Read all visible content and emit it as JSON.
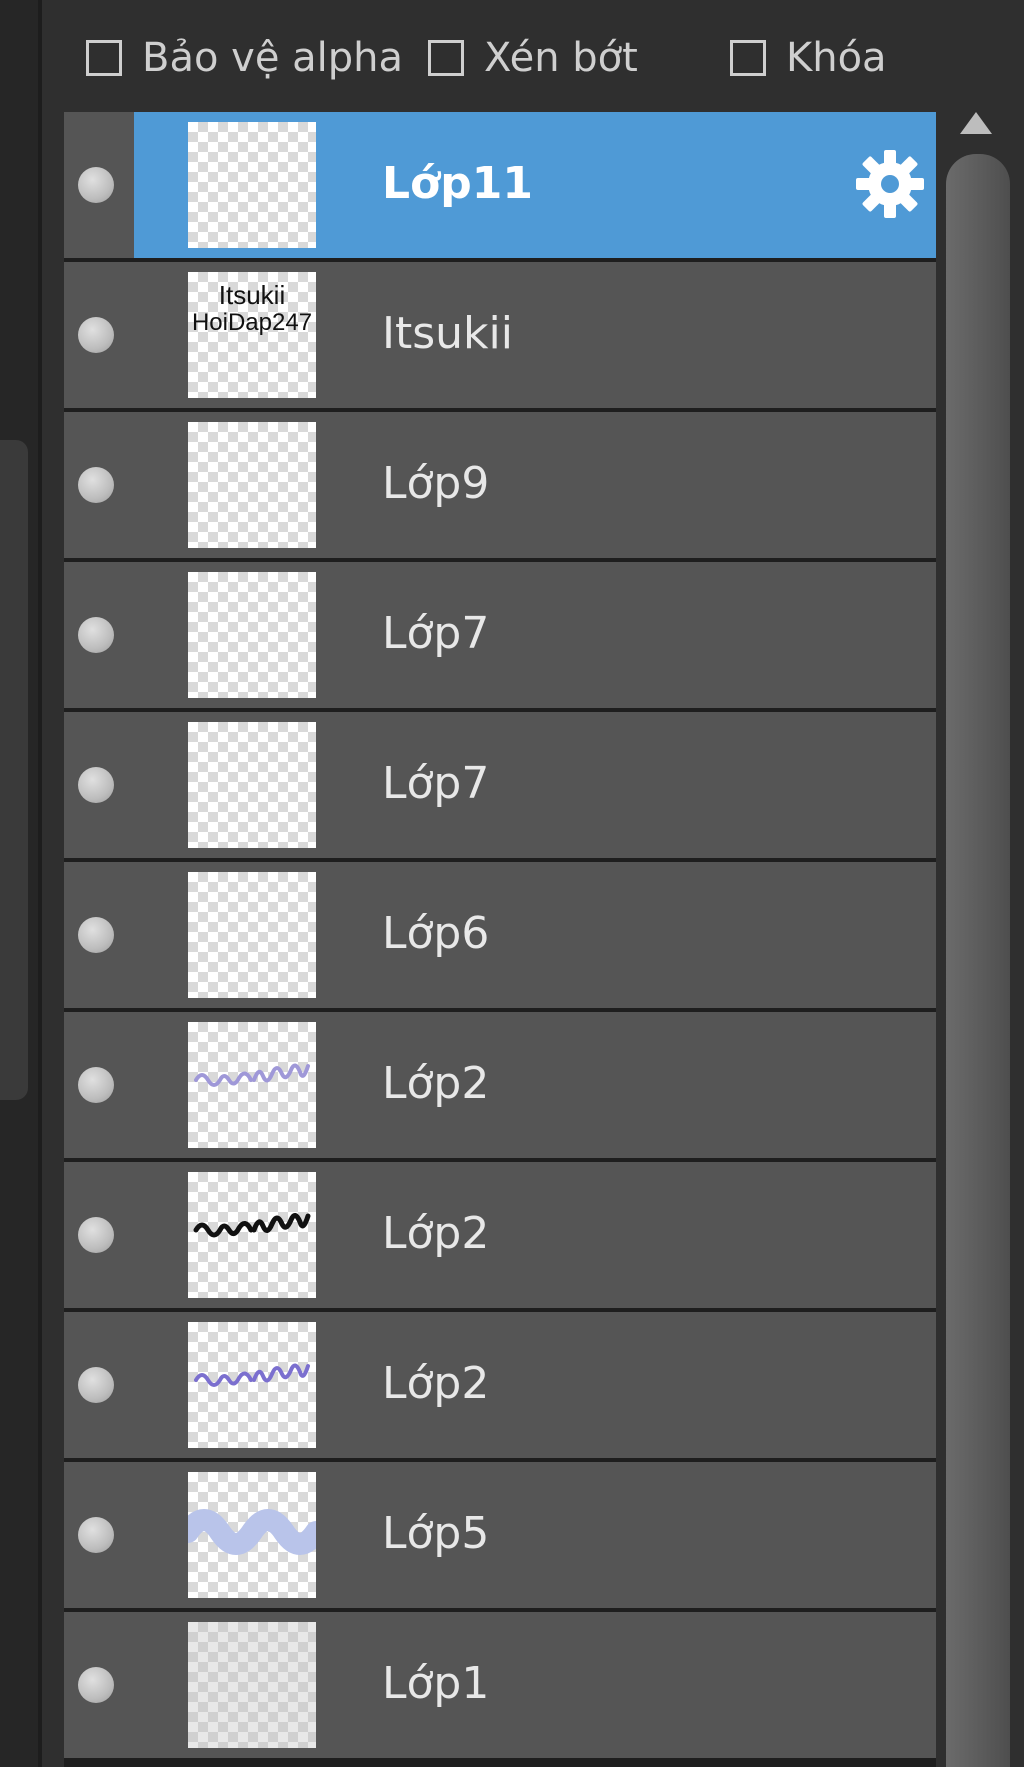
{
  "options": {
    "alpha_protect_label": "Bảo vệ alpha",
    "clip_label": "Xén bớt",
    "lock_label": "Khóa",
    "alpha_protect_checked": false,
    "clip_checked": false,
    "lock_checked": false
  },
  "layers": [
    {
      "name": "Lớp11",
      "selected": true,
      "thumb": "blank"
    },
    {
      "name": "Itsukii",
      "selected": false,
      "thumb": "text-black",
      "thumb_text": [
        "Itsukii",
        "HoiDap247"
      ]
    },
    {
      "name": "Lớp9",
      "selected": false,
      "thumb": "blank"
    },
    {
      "name": "Lớp7",
      "selected": false,
      "thumb": "blank"
    },
    {
      "name": "Lớp7",
      "selected": false,
      "thumb": "blank"
    },
    {
      "name": "Lớp6",
      "selected": false,
      "thumb": "blank"
    },
    {
      "name": "Lớp2",
      "selected": false,
      "thumb": "script-lavender"
    },
    {
      "name": "Lớp2",
      "selected": false,
      "thumb": "script-black"
    },
    {
      "name": "Lớp2",
      "selected": false,
      "thumb": "script-purple"
    },
    {
      "name": "Lớp5",
      "selected": false,
      "thumb": "wave-blue"
    },
    {
      "name": "Lớp1",
      "selected": false,
      "thumb": "dim"
    }
  ],
  "colors": {
    "selected_row": "#4f9ad6",
    "row": "#555555",
    "panel": "#2f2f2f"
  },
  "icons": {
    "settings": "gear-icon",
    "visibility": "visibility-dot-icon",
    "scroll_up": "triangle-up-icon"
  }
}
